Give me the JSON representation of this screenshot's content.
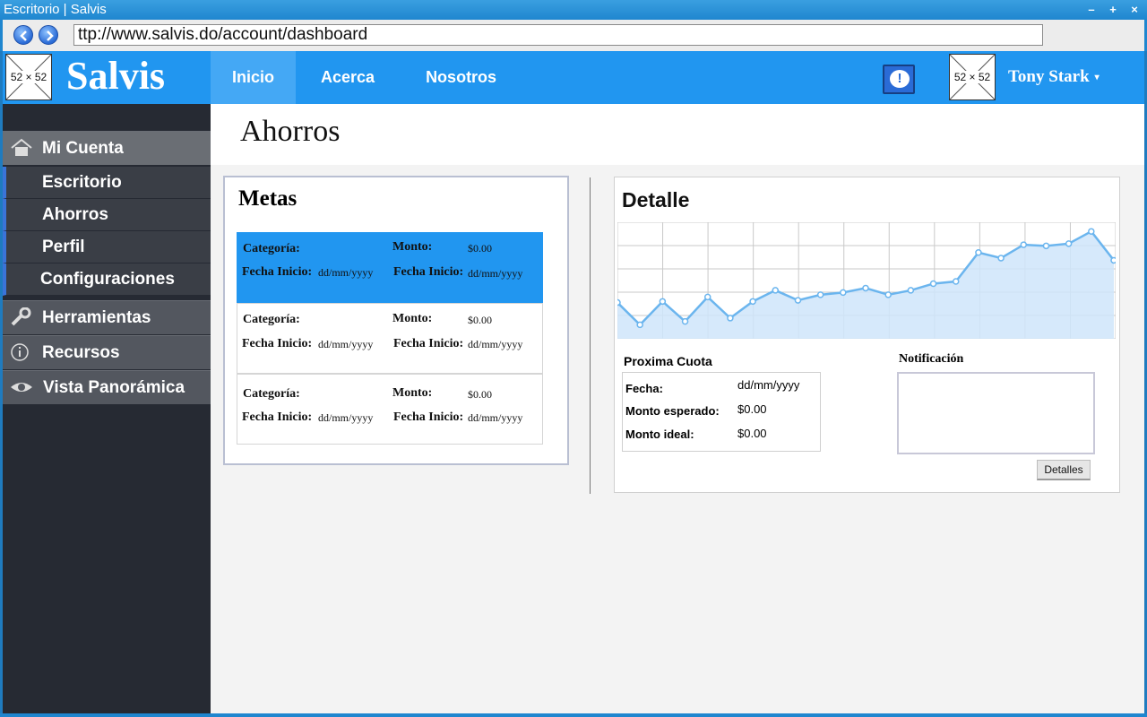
{
  "window": {
    "title": "Escritorio | Salvis",
    "controls": [
      "–",
      "+",
      "×"
    ]
  },
  "browser": {
    "url": "ttp://www.salvis.do/account/dashboard"
  },
  "header": {
    "logo_placeholder": "52 × 52",
    "brand": "Salvis",
    "nav": [
      {
        "label": "Inicio",
        "active": true
      },
      {
        "label": "Acerca",
        "active": false
      },
      {
        "label": "Nosotros",
        "active": false
      }
    ],
    "notification_icon": "!",
    "avatar_placeholder": "52 × 52",
    "user_name": "Tony Stark",
    "user_caret": "▾"
  },
  "sidebar": {
    "sections": [
      {
        "label": "Mi Cuenta",
        "icon": "home-icon"
      },
      {
        "label": "Herramientas",
        "icon": "wrench-icon"
      },
      {
        "label": "Recursos",
        "icon": "info-icon"
      },
      {
        "label": "Vista Panorámica",
        "icon": "eye-icon"
      }
    ],
    "sub_items": [
      "Escritorio",
      "Ahorros",
      "Perfil",
      "Configuraciones"
    ]
  },
  "page": {
    "title": "Ahorros"
  },
  "metas": {
    "title": "Metas",
    "goals": [
      {
        "categoria_label": "Categoría:",
        "monto_label": "Monto:",
        "monto_value": "$0.00",
        "fecha_label_1": "Fecha Inicio:",
        "fecha_value_1": "dd/mm/yyyy",
        "fecha_label_2": "Fecha Inicio:",
        "fecha_value_2": "dd/mm/yyyy",
        "selected": true
      },
      {
        "categoria_label": "Categoría:",
        "monto_label": "Monto:",
        "monto_value": "$0.00",
        "fecha_label_1": "Fecha Inicio:",
        "fecha_value_1": "dd/mm/yyyy",
        "fecha_label_2": "Fecha Inicio:",
        "fecha_value_2": "dd/mm/yyyy",
        "selected": false
      },
      {
        "categoria_label": "Categoría:",
        "monto_label": "Monto:",
        "monto_value": "$0.00",
        "fecha_label_1": "Fecha Inicio:",
        "fecha_value_1": "dd/mm/yyyy",
        "fecha_label_2": "Fecha Inicio:",
        "fecha_value_2": "dd/mm/yyyy",
        "selected": false
      }
    ]
  },
  "detalle": {
    "title": "Detalle",
    "proxima_cuota": {
      "title": "Proxima Cuota",
      "rows": [
        {
          "label": "Fecha:",
          "value": "dd/mm/yyyy"
        },
        {
          "label": "Monto esperado:",
          "value": "$0.00"
        },
        {
          "label": "Monto ideal:",
          "value": "$0.00"
        }
      ]
    },
    "notificacion": {
      "title": "Notificación",
      "value": ""
    },
    "detalles_button": "Detalles"
  },
  "chart_data": {
    "type": "area",
    "title": "",
    "xlabel": "",
    "ylabel": "",
    "grid": true,
    "ylim": [
      0,
      100
    ],
    "x": [
      1,
      2,
      3,
      4,
      5,
      6,
      7,
      8,
      9,
      10,
      11,
      12,
      13,
      14,
      15,
      16,
      17,
      18,
      19,
      20,
      21,
      22,
      23,
      24,
      25
    ],
    "series": [
      {
        "values": [
          31,
          11,
          32,
          14,
          36,
          17,
          32,
          42,
          33,
          38,
          40,
          44,
          38,
          42,
          48,
          50,
          76,
          71,
          83,
          82,
          84,
          95,
          69
        ]
      }
    ],
    "colors": {
      "line": "#6bb5ee",
      "fill": "#cfe5fa",
      "grid": "#c9c9c9"
    }
  },
  "colors": {
    "accent": "#2196f0",
    "sidebar": "#262a33",
    "sidebar_active": "#3b74d8"
  }
}
